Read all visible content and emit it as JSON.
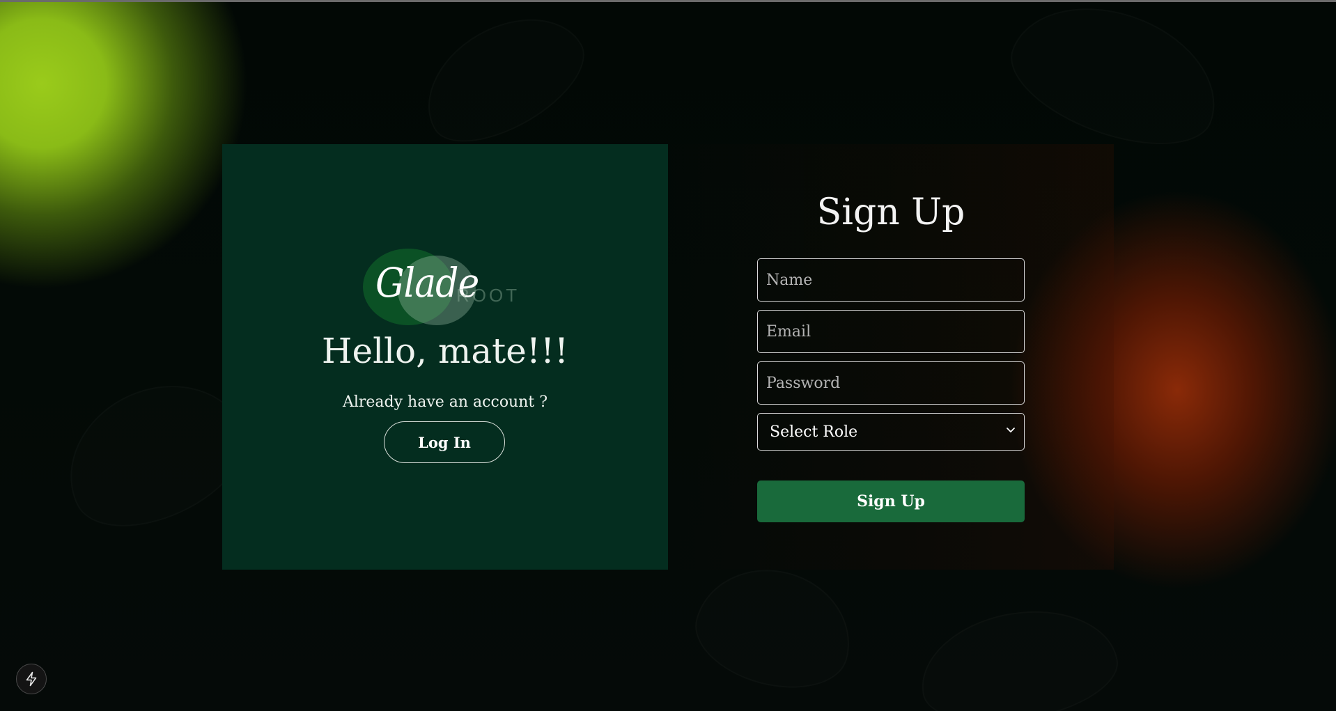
{
  "branding": {
    "logo_script": "Glade",
    "logo_word": "ROOT"
  },
  "welcome": {
    "heading": "Hello, mate!!!",
    "prompt": "Already have an account ?",
    "login_label": "Log In"
  },
  "signup": {
    "title": "Sign Up",
    "name_placeholder": "Name",
    "email_placeholder": "Email",
    "password_placeholder": "Password",
    "role_selected": "Select Role",
    "submit_label": "Sign Up"
  },
  "icons": {
    "dev_indicator": "lightning-bolt-icon",
    "select_chevron": "chevron-down-icon"
  },
  "colors": {
    "left_panel": "#042d1f",
    "primary_button": "#196a3b",
    "glow_green": "#9acb1b",
    "glow_orange": "#8a2a08"
  }
}
